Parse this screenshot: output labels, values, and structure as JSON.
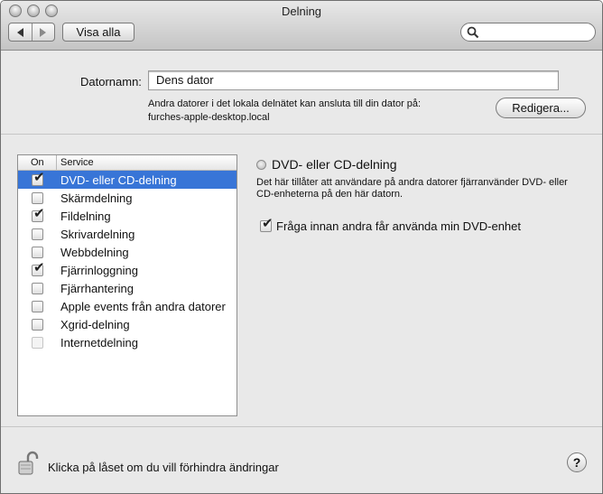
{
  "window": {
    "title": "Delning"
  },
  "toolbar": {
    "show_all_label": "Visa alla",
    "search_placeholder": ""
  },
  "computer": {
    "name_label": "Datornamn:",
    "name_value": "Dens dator",
    "info_line": "Andra datorer i det lokala delnätet kan ansluta till din dator på:",
    "hostname": "furches-apple-desktop.local",
    "edit_button": "Redigera..."
  },
  "services": {
    "header_on": "On",
    "header_service": "Service",
    "items": [
      {
        "label": "DVD- eller CD-delning",
        "checked": true,
        "selected": true,
        "enabled": true
      },
      {
        "label": "Skärmdelning",
        "checked": false,
        "selected": false,
        "enabled": true
      },
      {
        "label": "Fildelning",
        "checked": true,
        "selected": false,
        "enabled": true
      },
      {
        "label": "Skrivardelning",
        "checked": false,
        "selected": false,
        "enabled": true
      },
      {
        "label": "Webbdelning",
        "checked": false,
        "selected": false,
        "enabled": true
      },
      {
        "label": "Fjärrinloggning",
        "checked": true,
        "selected": false,
        "enabled": true
      },
      {
        "label": "Fjärrhantering",
        "checked": false,
        "selected": false,
        "enabled": true
      },
      {
        "label": "Apple events från andra datorer",
        "checked": false,
        "selected": false,
        "enabled": true
      },
      {
        "label": "Xgrid-delning",
        "checked": false,
        "selected": false,
        "enabled": true
      },
      {
        "label": "Internetdelning",
        "checked": false,
        "selected": false,
        "enabled": false
      }
    ]
  },
  "detail": {
    "title": "DVD- eller CD-delning",
    "description": "Det här tillåter att användare på andra datorer fjärranvänder DVD- eller CD-enheterna på den här datorn.",
    "option_label": "Fråga innan andra får använda min DVD-enhet",
    "option_checked": true
  },
  "footer": {
    "lock_text": "Klicka på låset om du vill förhindra ändringar",
    "help_label": "?"
  },
  "colors": {
    "selection": "#3875d7"
  }
}
